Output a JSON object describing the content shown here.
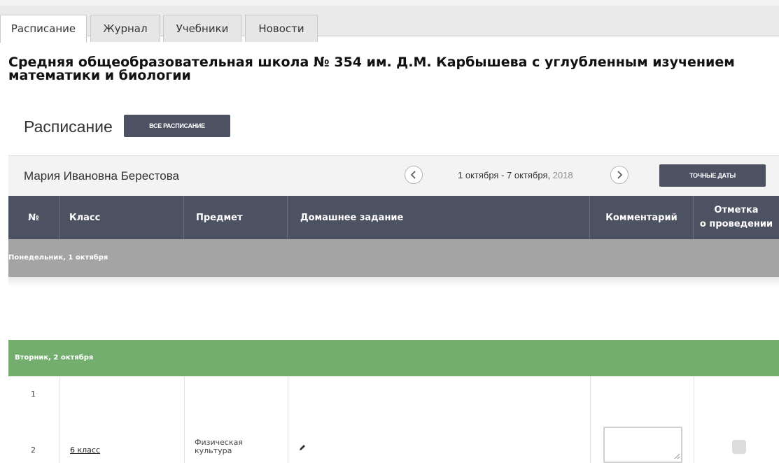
{
  "tabs": [
    {
      "label": "Расписание",
      "active": true
    },
    {
      "label": "Журнал",
      "active": false
    },
    {
      "label": "Учебники",
      "active": false
    },
    {
      "label": "Новости",
      "active": false
    }
  ],
  "school_title_line1": "Средняя общеобразовательная школа № 354 им. Д.М. Карбышева с углубленным изучением",
  "school_title_line2": "математики и биологии",
  "schedule": {
    "heading": "Расписание",
    "all_button": "ВСЕ РАСПИСАНИЕ",
    "teacher": "Мария Ивановна Берестова",
    "date_range": "1 октября - 7 октября,",
    "year": "2018",
    "exact_dates_button": "ТОЧНЫЕ ДАТЫ"
  },
  "table": {
    "headers": {
      "num": "№",
      "class": "Класс",
      "subject": "Предмет",
      "homework": "Домашнее задание",
      "comment": "Комментарий",
      "mark_line1": "Отметка",
      "mark_line2": "о проведении"
    },
    "days": [
      {
        "label": "Понедельник, 1 октября"
      },
      {
        "label": "Вторник, 2 октября"
      }
    ],
    "rows": [
      {
        "num": "1",
        "class": "",
        "subject_line1": "",
        "subject_line2": ""
      },
      {
        "num": "2",
        "class": "6 класс",
        "subject_line1": "Физическая",
        "subject_line2": "культура"
      }
    ]
  },
  "colors": {
    "header_bg": "#4d5263",
    "monday_bg": "#a4a4a4",
    "tuesday_bg": "#74ae6e"
  }
}
